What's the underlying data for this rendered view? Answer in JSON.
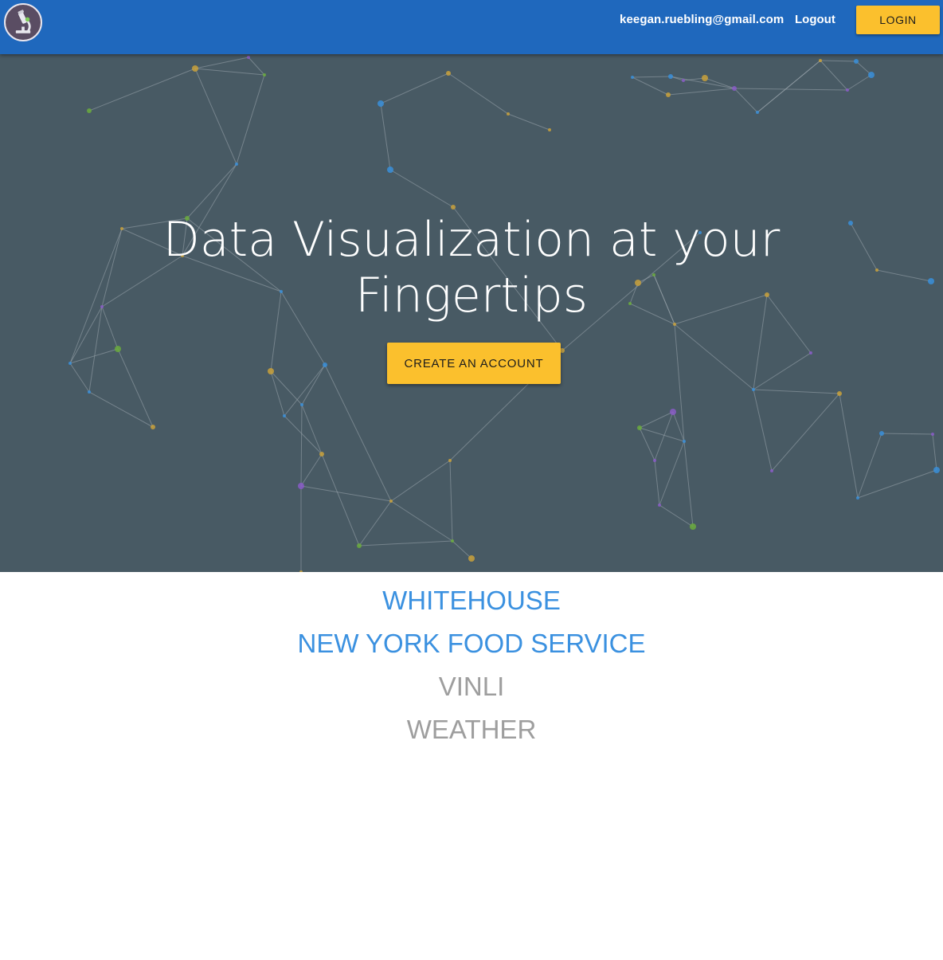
{
  "header": {
    "logo_icon": "microscope-icon",
    "user_email": "keegan.ruebling@gmail.com",
    "logout_label": "Logout",
    "login_label": "LOGIN"
  },
  "hero": {
    "title_line1": "Data Visualization at your",
    "title_line2": "Fingertips",
    "cta_label": "CREATE AN ACCOUNT",
    "background_color": "#485a64"
  },
  "datasets": [
    {
      "label": "WHITEHOUSE",
      "color": "#3b91e0"
    },
    {
      "label": "NEW YORK FOOD SERVICE",
      "color": "#3b91e0"
    },
    {
      "label": "VINLI",
      "color": "#9e9e9e"
    },
    {
      "label": "WEATHER",
      "color": "#9e9e9e"
    }
  ],
  "colors": {
    "header_bg": "#1f68bd",
    "accent": "#fbc02d",
    "link_active": "#3b91e0",
    "link_inactive": "#9e9e9e",
    "node_colors": [
      "#c9a13b",
      "#8a5cc7",
      "#6bab3d",
      "#3a8fd9"
    ]
  }
}
